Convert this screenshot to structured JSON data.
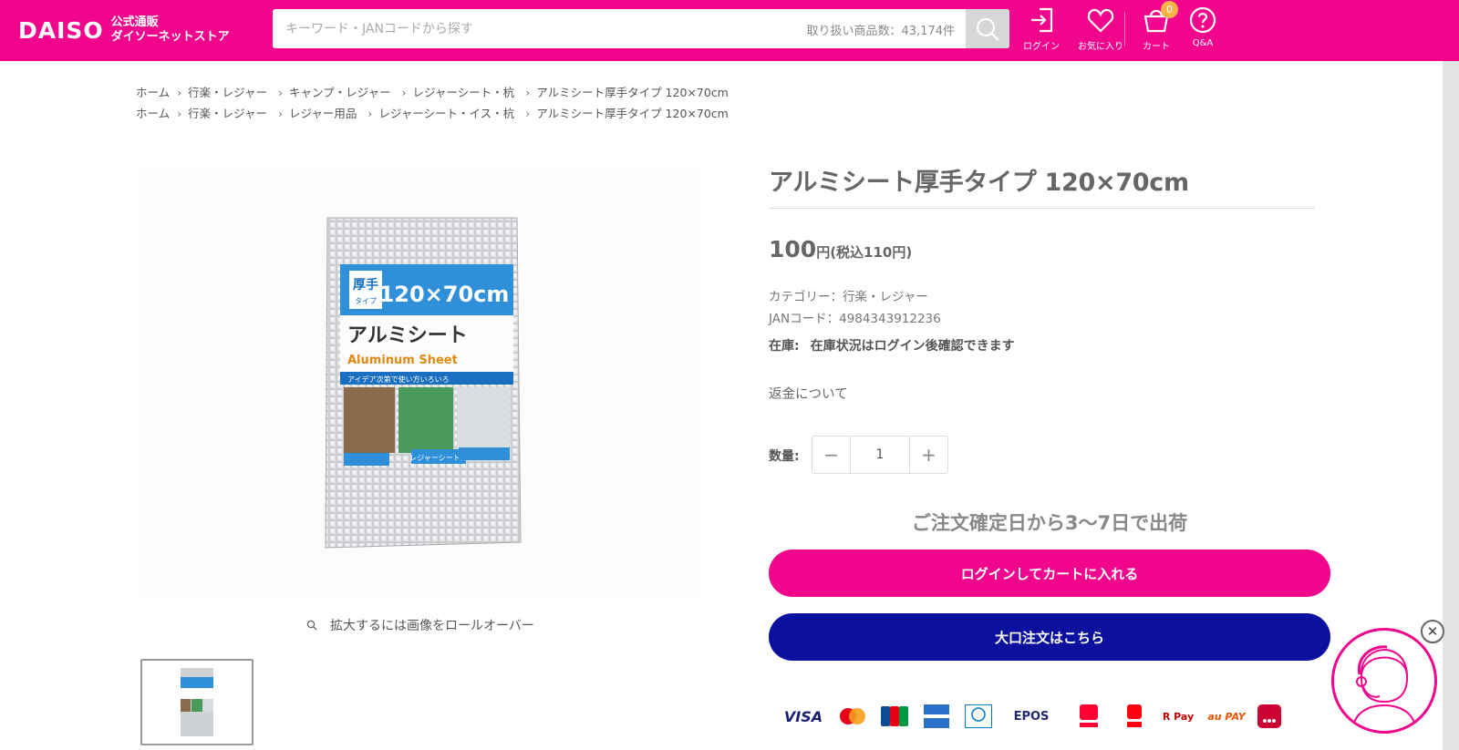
{
  "brand": {
    "logo_text": "DAISO",
    "sub_line1": "公式通販",
    "sub_line2": "ダイソーネットストア",
    "color": "#f0058c"
  },
  "search": {
    "placeholder": "キーワード・JANコードから探す",
    "count_text": "取り扱い商品数：43,174件"
  },
  "header_nav": {
    "login": "ログイン",
    "favorites": "お気に入り",
    "cart": "カート",
    "cart_count": "0",
    "qa": "Q&A"
  },
  "breadcrumbs": [
    [
      "ホーム",
      "行楽・レジャー",
      "キャンプ・レジャー",
      "レジャーシート・杭",
      "アルミシート厚手タイプ 120×70cm"
    ],
    [
      "ホーム",
      "行楽・レジャー",
      "レジャー用品",
      "レジャーシート・イス・杭",
      "アルミシート厚手タイプ 120×70cm"
    ]
  ],
  "product": {
    "title": "アルミシート厚手タイプ 120×70cm",
    "price": "100",
    "price_unit": "円",
    "price_tax": "(税込110円)",
    "category": "カテゴリー：行楽・レジャー",
    "jan": "JANコード：4984343912236",
    "stock_label": "在庫:",
    "stock_value": "在庫状況はログイン後確認できます",
    "refund_link": "返金について",
    "quantity_label": "数量:",
    "quantity_value": "1",
    "shipping_note": "ご注文確定日から3〜7日で出荷",
    "add_to_cart": "ログインしてカートに入れる",
    "bulk_order": "大口注文はこちら",
    "zoom_hint": "拡大するには画像をロールオーバー"
  },
  "package_art": {
    "badge1": "厚手",
    "badge2": "タイプ",
    "size": "120×70cm",
    "name_jp": "アルミシート",
    "name_en": "Aluminum Sheet",
    "tagline": "アイデア次第で使い方いろいろ",
    "tag1": "レジャーシートに"
  },
  "payments": [
    "VISA",
    "Mastercard",
    "JCB",
    "AMERICAN EXPRESS",
    "Diners Club",
    "EPOS",
    "PayPay",
    "Pay",
    "R Pay",
    "au PAY",
    "d払い"
  ],
  "colors": {
    "primary": "#f0058c",
    "navy": "#0c109e",
    "badge": "#f7b34a"
  }
}
